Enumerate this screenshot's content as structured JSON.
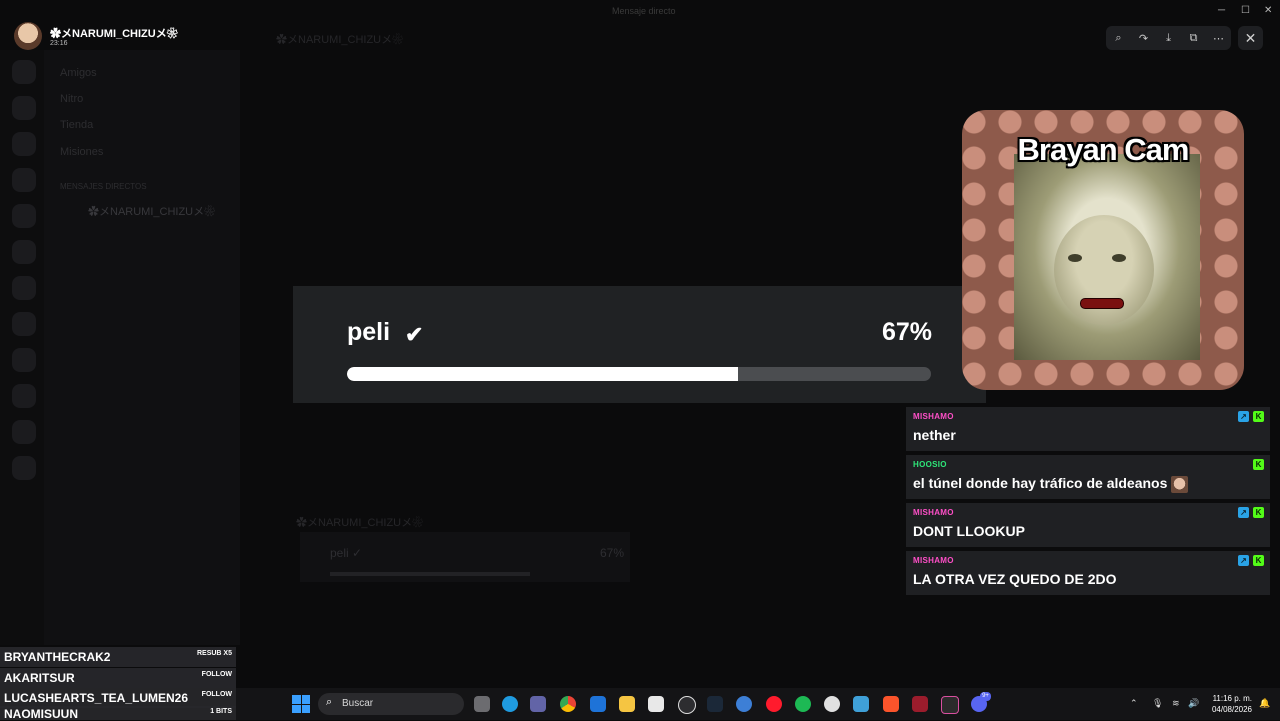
{
  "window": {
    "title": "Mensaje directo"
  },
  "header": {
    "username": "✿メNARUMI_CHIZUメ❀",
    "time": "23:16"
  },
  "viewer": {
    "tools": [
      "zoom-icon",
      "forward-icon",
      "download-icon",
      "open-external-icon",
      "more-icon"
    ],
    "close": "✕"
  },
  "background": {
    "channel_name": "✿メNARUMI_CHIZUメ❀",
    "sidebar_items": [
      "Amigos",
      "Nitro",
      "Tienda",
      "Misiones"
    ],
    "dm_label": "MENSAJES DIRECTOS",
    "poll_copy": {
      "title": "peli ✓",
      "pct": "67%"
    }
  },
  "poll": {
    "title": "peli",
    "pct_label": "67%",
    "progress": 0.67
  },
  "cam": {
    "title": "Brayan Cam"
  },
  "chat": [
    {
      "user": "MISHAMO",
      "color": "#ff4fc8",
      "text": "nether",
      "badges": [
        "prime",
        "kick"
      ]
    },
    {
      "user": "HOOSIO",
      "color": "#2ee87a",
      "text": "el túnel donde hay tráfico de aldeanos",
      "badges": [
        "kick"
      ],
      "emote": true
    },
    {
      "user": "MISHAMO",
      "color": "#ff4fc8",
      "text": "DONT LLOOKUP",
      "badges": [
        "prime",
        "kick"
      ]
    },
    {
      "user": "MISHAMO",
      "color": "#ff4fc8",
      "text": "LA OTRA VEZ QUEDO DE 2DO",
      "badges": [
        "prime",
        "kick"
      ]
    }
  ],
  "events": [
    {
      "name": "BRYANTHECRAK2",
      "tag": "RESUB X5"
    },
    {
      "name": "AKARITSUR",
      "tag": "FOLLOW"
    },
    {
      "name": "LUCASHEARTS_TEA_LUMEN26",
      "tag": "FOLLOW"
    },
    {
      "name": "NAOMISUUN",
      "tag": "1 BITS"
    }
  ],
  "taskbar": {
    "search_label": "Buscar",
    "time": "11:16 p. m.",
    "date": "04/08/2026",
    "notification_count": "9+"
  }
}
